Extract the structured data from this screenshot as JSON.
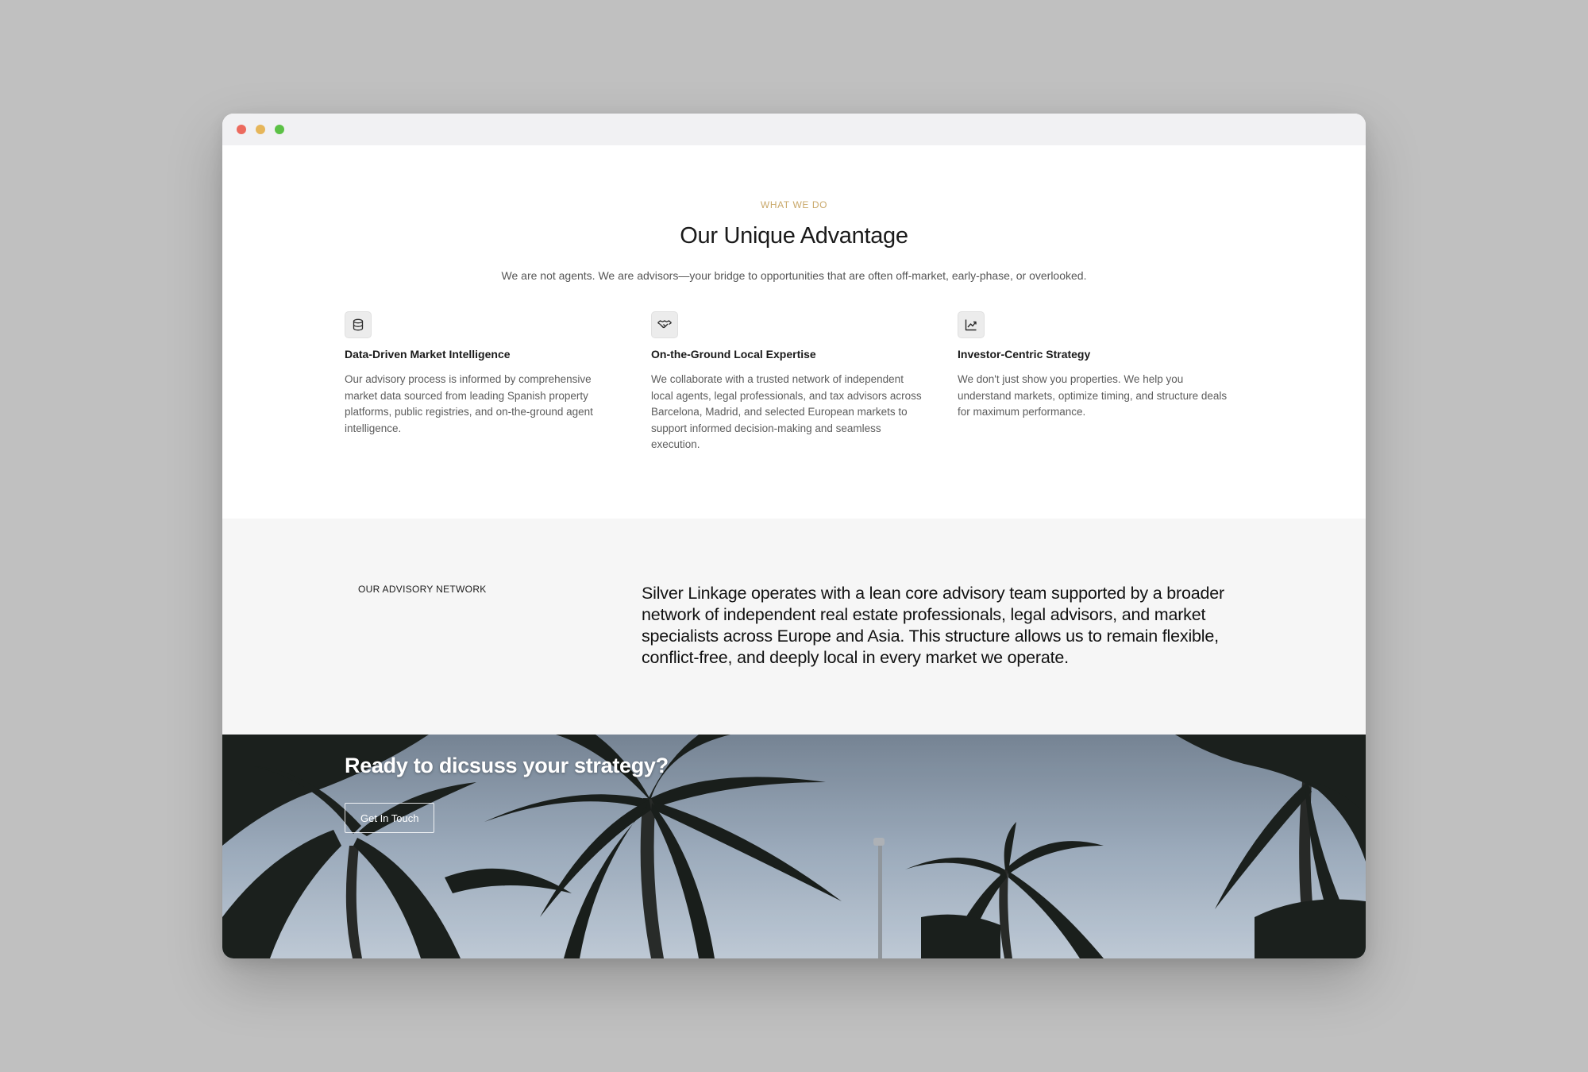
{
  "window": {
    "controls": [
      "close",
      "minimize",
      "maximize"
    ],
    "control_colors": {
      "close": "#ec6a5e",
      "minimize": "#e6b65a",
      "maximize": "#5cc146"
    }
  },
  "advantage": {
    "eyebrow": "WHAT WE DO",
    "eyebrow_color": "#c9a86a",
    "title": "Our Unique Advantage",
    "intro": "We are not agents. We are advisors—your bridge to opportunities that are often off-market, early-phase, or overlooked.",
    "features": [
      {
        "icon": "database-icon",
        "title": "Data-Driven Market Intelligence",
        "description": "Our advisory process is informed by comprehensive market data sourced from leading Spanish property platforms, public registries, and on-the-ground agent intelligence."
      },
      {
        "icon": "handshake-icon",
        "title": "On-the-Ground Local Expertise",
        "description": "We collaborate with a trusted network of independent local agents, legal professionals, and tax advisors across Barcelona, Madrid, and selected European markets to support informed decision-making and seamless execution."
      },
      {
        "icon": "chart-icon",
        "title": "Investor-Centric Strategy",
        "description": "We don't just show you properties. We help you understand markets, optimize timing, and structure deals for maximum performance."
      }
    ]
  },
  "network": {
    "label": "OUR ADVISORY NETWORK",
    "text": "Silver Linkage operates with a lean core advisory team supported by a broader network of independent real estate professionals, legal advisors, and market specialists across Europe and Asia. This structure allows us to remain flexible, conflict-free, and deeply local in every market we operate."
  },
  "cta": {
    "title": "Ready to dicsuss your strategy?",
    "button_label": "Get In Touch",
    "background_image": "palm-trees-sky"
  }
}
